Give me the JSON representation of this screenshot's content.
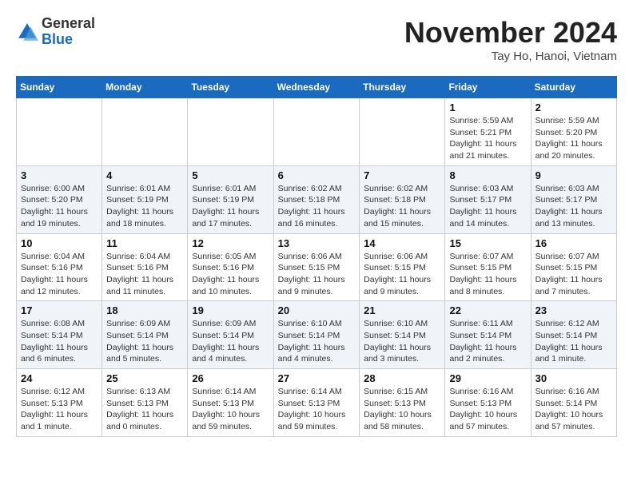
{
  "header": {
    "logo_general": "General",
    "logo_blue": "Blue",
    "month": "November 2024",
    "location": "Tay Ho, Hanoi, Vietnam"
  },
  "weekdays": [
    "Sunday",
    "Monday",
    "Tuesday",
    "Wednesday",
    "Thursday",
    "Friday",
    "Saturday"
  ],
  "weeks": [
    {
      "days": [
        {
          "num": "",
          "info": ""
        },
        {
          "num": "",
          "info": ""
        },
        {
          "num": "",
          "info": ""
        },
        {
          "num": "",
          "info": ""
        },
        {
          "num": "",
          "info": ""
        },
        {
          "num": "1",
          "info": "Sunrise: 5:59 AM\nSunset: 5:21 PM\nDaylight: 11 hours\nand 21 minutes."
        },
        {
          "num": "2",
          "info": "Sunrise: 5:59 AM\nSunset: 5:20 PM\nDaylight: 11 hours\nand 20 minutes."
        }
      ]
    },
    {
      "days": [
        {
          "num": "3",
          "info": "Sunrise: 6:00 AM\nSunset: 5:20 PM\nDaylight: 11 hours\nand 19 minutes."
        },
        {
          "num": "4",
          "info": "Sunrise: 6:01 AM\nSunset: 5:19 PM\nDaylight: 11 hours\nand 18 minutes."
        },
        {
          "num": "5",
          "info": "Sunrise: 6:01 AM\nSunset: 5:19 PM\nDaylight: 11 hours\nand 17 minutes."
        },
        {
          "num": "6",
          "info": "Sunrise: 6:02 AM\nSunset: 5:18 PM\nDaylight: 11 hours\nand 16 minutes."
        },
        {
          "num": "7",
          "info": "Sunrise: 6:02 AM\nSunset: 5:18 PM\nDaylight: 11 hours\nand 15 minutes."
        },
        {
          "num": "8",
          "info": "Sunrise: 6:03 AM\nSunset: 5:17 PM\nDaylight: 11 hours\nand 14 minutes."
        },
        {
          "num": "9",
          "info": "Sunrise: 6:03 AM\nSunset: 5:17 PM\nDaylight: 11 hours\nand 13 minutes."
        }
      ]
    },
    {
      "days": [
        {
          "num": "10",
          "info": "Sunrise: 6:04 AM\nSunset: 5:16 PM\nDaylight: 11 hours\nand 12 minutes."
        },
        {
          "num": "11",
          "info": "Sunrise: 6:04 AM\nSunset: 5:16 PM\nDaylight: 11 hours\nand 11 minutes."
        },
        {
          "num": "12",
          "info": "Sunrise: 6:05 AM\nSunset: 5:16 PM\nDaylight: 11 hours\nand 10 minutes."
        },
        {
          "num": "13",
          "info": "Sunrise: 6:06 AM\nSunset: 5:15 PM\nDaylight: 11 hours\nand 9 minutes."
        },
        {
          "num": "14",
          "info": "Sunrise: 6:06 AM\nSunset: 5:15 PM\nDaylight: 11 hours\nand 9 minutes."
        },
        {
          "num": "15",
          "info": "Sunrise: 6:07 AM\nSunset: 5:15 PM\nDaylight: 11 hours\nand 8 minutes."
        },
        {
          "num": "16",
          "info": "Sunrise: 6:07 AM\nSunset: 5:15 PM\nDaylight: 11 hours\nand 7 minutes."
        }
      ]
    },
    {
      "days": [
        {
          "num": "17",
          "info": "Sunrise: 6:08 AM\nSunset: 5:14 PM\nDaylight: 11 hours\nand 6 minutes."
        },
        {
          "num": "18",
          "info": "Sunrise: 6:09 AM\nSunset: 5:14 PM\nDaylight: 11 hours\nand 5 minutes."
        },
        {
          "num": "19",
          "info": "Sunrise: 6:09 AM\nSunset: 5:14 PM\nDaylight: 11 hours\nand 4 minutes."
        },
        {
          "num": "20",
          "info": "Sunrise: 6:10 AM\nSunset: 5:14 PM\nDaylight: 11 hours\nand 4 minutes."
        },
        {
          "num": "21",
          "info": "Sunrise: 6:10 AM\nSunset: 5:14 PM\nDaylight: 11 hours\nand 3 minutes."
        },
        {
          "num": "22",
          "info": "Sunrise: 6:11 AM\nSunset: 5:14 PM\nDaylight: 11 hours\nand 2 minutes."
        },
        {
          "num": "23",
          "info": "Sunrise: 6:12 AM\nSunset: 5:14 PM\nDaylight: 11 hours\nand 1 minute."
        }
      ]
    },
    {
      "days": [
        {
          "num": "24",
          "info": "Sunrise: 6:12 AM\nSunset: 5:13 PM\nDaylight: 11 hours\nand 1 minute."
        },
        {
          "num": "25",
          "info": "Sunrise: 6:13 AM\nSunset: 5:13 PM\nDaylight: 11 hours\nand 0 minutes."
        },
        {
          "num": "26",
          "info": "Sunrise: 6:14 AM\nSunset: 5:13 PM\nDaylight: 10 hours\nand 59 minutes."
        },
        {
          "num": "27",
          "info": "Sunrise: 6:14 AM\nSunset: 5:13 PM\nDaylight: 10 hours\nand 59 minutes."
        },
        {
          "num": "28",
          "info": "Sunrise: 6:15 AM\nSunset: 5:13 PM\nDaylight: 10 hours\nand 58 minutes."
        },
        {
          "num": "29",
          "info": "Sunrise: 6:16 AM\nSunset: 5:13 PM\nDaylight: 10 hours\nand 57 minutes."
        },
        {
          "num": "30",
          "info": "Sunrise: 6:16 AM\nSunset: 5:14 PM\nDaylight: 10 hours\nand 57 minutes."
        }
      ]
    }
  ]
}
